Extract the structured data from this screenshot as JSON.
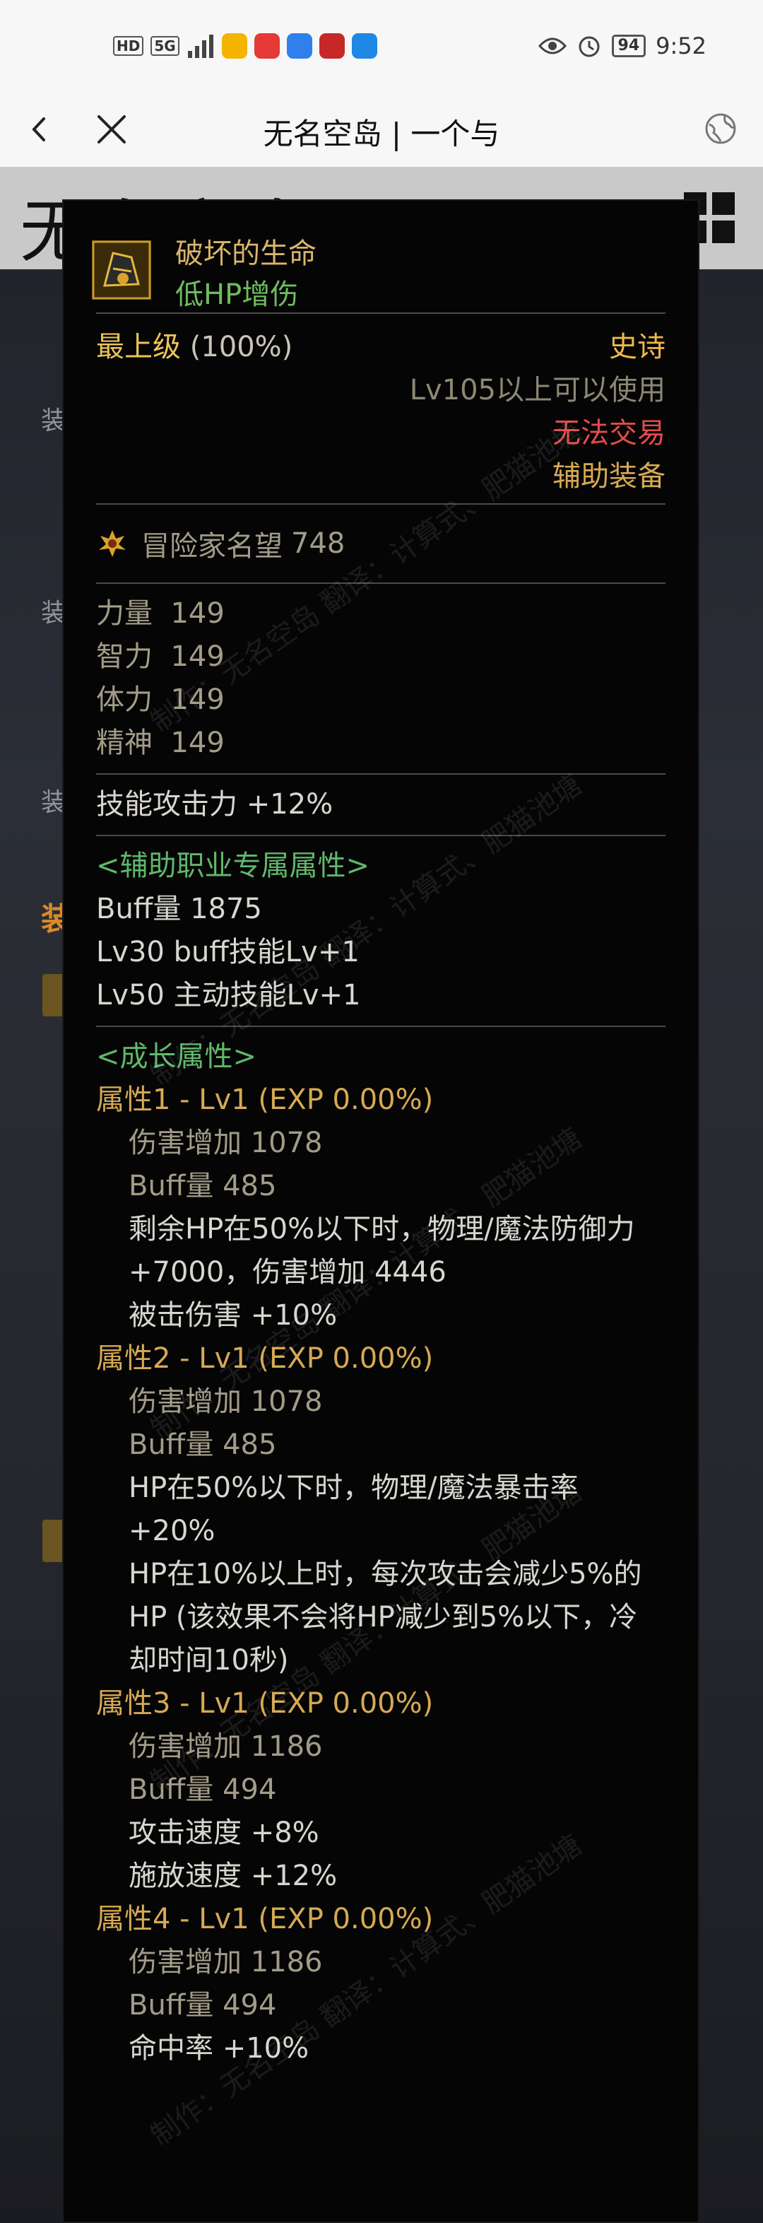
{
  "status_bar": {
    "left_tags": [
      "HD",
      "5G"
    ],
    "time": "9:52",
    "battery": "94"
  },
  "nav": {
    "title": "无名空岛 | 一个与"
  },
  "background": {
    "logo_text": "无名空岛",
    "labels": [
      "装",
      "装",
      "装"
    ],
    "section_label": "装"
  },
  "tooltip": {
    "item_name": "破坏的生命",
    "item_subtitle": "低HP增伤",
    "grade_label": "最上级",
    "grade_value": "(100%)",
    "rarity": "史诗",
    "level_req": "Lv105以上可以使用",
    "trade": "无法交易",
    "category": "辅助装备",
    "fame_label": "冒险家名望",
    "fame_value": "748",
    "stats": [
      {
        "name": "力量",
        "value": "149"
      },
      {
        "name": "智力",
        "value": "149"
      },
      {
        "name": "体力",
        "value": "149"
      },
      {
        "name": "精神",
        "value": "149"
      }
    ],
    "skill_atk": "技能攻击力  +12%",
    "support_header": "<辅助职业专属属性>",
    "support_lines": [
      "Buff量   1875",
      "Lv30 buff技能Lv+1",
      "Lv50 主动技能Lv+1"
    ],
    "growth_header": "<成长属性>",
    "growth": [
      {
        "title": "属性1 - Lv1 (EXP 0.00%)",
        "dmg": "伤害增加   1078",
        "buff": "Buff量   485",
        "effects": [
          "剩余HP在50%以下时，物理/魔法防御力 +7000，伤害增加 4446",
          "被击伤害 +10%"
        ]
      },
      {
        "title": "属性2 - Lv1 (EXP 0.00%)",
        "dmg": "伤害增加   1078",
        "buff": "Buff量   485",
        "effects": [
          "HP在50%以下时，物理/魔法暴击率 +20%",
          "HP在10%以上时，每次攻击会减少5%的 HP (该效果不会将HP减少到5%以下，冷却时间10秒)"
        ]
      },
      {
        "title": "属性3 - Lv1 (EXP 0.00%)",
        "dmg": "伤害增加   1186",
        "buff": "Buff量   494",
        "effects": [
          "攻击速度 +8%",
          "施放速度 +12%"
        ]
      },
      {
        "title": "属性4 - Lv1 (EXP 0.00%)",
        "dmg": "伤害增加   1186",
        "buff": "Buff量   494",
        "effects": [
          "命中率 +10%"
        ]
      }
    ],
    "watermark": "制作：无名空岛  翻译：计算式、肥猫池塘"
  }
}
